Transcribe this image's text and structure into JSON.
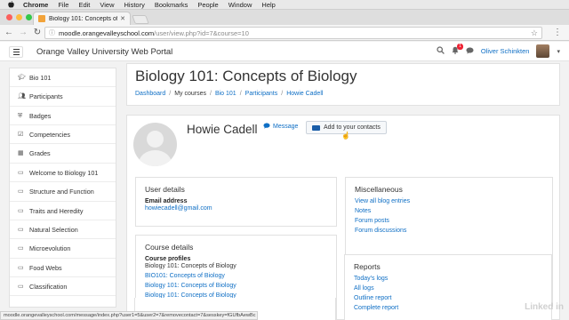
{
  "mac_menu": {
    "app": "Chrome",
    "items": [
      "File",
      "Edit",
      "View",
      "History",
      "Bookmarks",
      "People",
      "Window",
      "Help"
    ],
    "user": "Oliver"
  },
  "browser": {
    "tab_title": "Biology 101: Concepts of Bio...",
    "url_host": "moodle.orangevalleyschool.com",
    "url_path": "/user/view.php?id=7&course=10"
  },
  "site": {
    "name": "Orange Valley University Web Portal",
    "user_name": "Oliver Schinkten",
    "notification_count": "1"
  },
  "sidebar": {
    "items": [
      {
        "label": "Bio 101",
        "icon": "graduation-cap-icon"
      },
      {
        "label": "Participants",
        "icon": "users-icon"
      },
      {
        "label": "Badges",
        "icon": "shield-icon"
      },
      {
        "label": "Competencies",
        "icon": "check-square-icon"
      },
      {
        "label": "Grades",
        "icon": "table-icon"
      },
      {
        "label": "Welcome to Biology 101",
        "icon": "folder-icon"
      },
      {
        "label": "Structure and Function",
        "icon": "folder-icon"
      },
      {
        "label": "Traits and Heredity",
        "icon": "folder-icon"
      },
      {
        "label": "Natural Selection",
        "icon": "folder-icon"
      },
      {
        "label": "Microevolution",
        "icon": "folder-icon"
      },
      {
        "label": "Food Webs",
        "icon": "folder-icon"
      },
      {
        "label": "Classification",
        "icon": "folder-icon"
      }
    ]
  },
  "page": {
    "title": "Biology 101: Concepts of Biology",
    "breadcrumbs": [
      "Dashboard",
      "My courses",
      "Bio 101",
      "Participants",
      "Howie Cadell"
    ]
  },
  "profile": {
    "name": "Howie Cadell",
    "message_label": "Message",
    "add_contact_label": "Add to your contacts"
  },
  "user_details": {
    "heading": "User details",
    "email_label": "Email address",
    "email": "howiecadell@gmail.com"
  },
  "course_details": {
    "heading": "Course details",
    "profiles_label": "Course profiles",
    "courses": [
      "Biology 101: Concepts of Biology",
      "BIO101: Concepts of Biology",
      "Biology 101: Concepts of Biology",
      "Biology 101: Concepts of Biology"
    ]
  },
  "miscellaneous": {
    "heading": "Miscellaneous",
    "links": [
      "View all blog entries",
      "Notes",
      "Forum posts",
      "Forum discussions"
    ]
  },
  "reports": {
    "heading": "Reports",
    "links": [
      "Today's logs",
      "All logs",
      "Outline report",
      "Complete report"
    ]
  },
  "status_bar": "moodle.orangevalleyschool.com/message/index.php?user1=5&user2=7&removecontact=7&sesskey=fGUfbAewBc",
  "watermark": "Linked in"
}
